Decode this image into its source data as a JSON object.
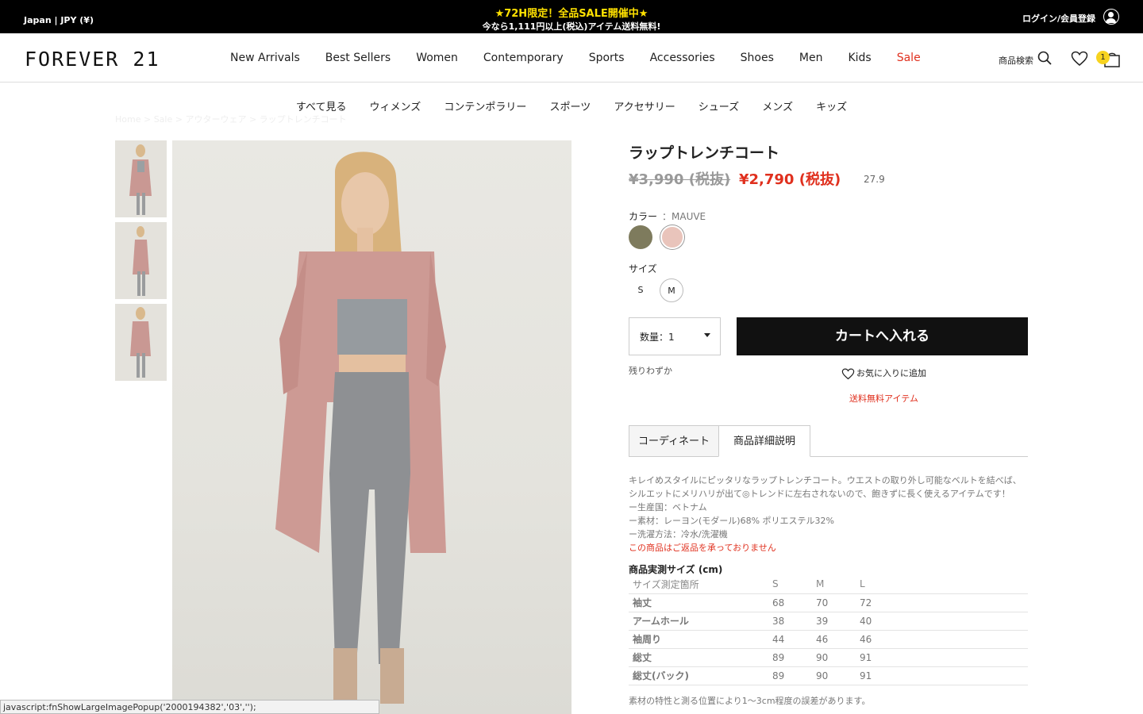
{
  "topbar": {
    "locale": "Japan | JPY (¥)",
    "promo_line1": "★72H限定！全品SALE開催中★",
    "promo_line2": "今なら1,111円以上(税込)アイテム送料無料!",
    "login": "ログイン/会員登録"
  },
  "header": {
    "logo": "FOREVER 21",
    "nav": [
      "New Arrivals",
      "Best Sellers",
      "Women",
      "Contemporary",
      "Sports",
      "Accessories",
      "Shoes",
      "Men",
      "Kids",
      "Sale"
    ],
    "search_label": "商品検索",
    "cart_count": "1"
  },
  "subnav": [
    "すべて見る",
    "ウィメンズ",
    "コンテンポラリー",
    "スポーツ",
    "アクセサリー",
    "シューズ",
    "メンズ",
    "キッズ"
  ],
  "breadcrumb": "Home > Sale > アウターウェア > ラップトレンチコート",
  "product": {
    "title": "ラップトレンチコート",
    "old_price": "¥3,990 (税抜)",
    "new_price": "¥2,790 (税抜)",
    "code": "27.9",
    "color_label": "カラー",
    "color_value": "：MAUVE",
    "colors": [
      "#7e7b5d",
      "#e9c4bb"
    ],
    "size_label": "サイズ",
    "sizes": [
      "S",
      "M"
    ],
    "qty_label": "数量：1",
    "cart_button": "カートへ入れる",
    "stock": "残りわずか",
    "favorite": "お気に入りに追加",
    "free_shipping": "送料無料アイテム"
  },
  "tabs": [
    "コーディネート",
    "商品詳細説明"
  ],
  "description": {
    "line1": "キレイめスタイルにピッタリなラップトレンチコート。ウエストの取り外し可能なベルトを結べば、シルエットにメリハリが出て◎トレンドに左右されないので、飽きずに長く使えるアイテムです！",
    "origin": "ー生産国：ベトナム",
    "material": "ー素材：レーヨン(モダール)68% ポリエステル32%",
    "wash": "ー洗濯方法：冷水/洗濯機",
    "warning": "この商品はご返品を承っておりません"
  },
  "size_chart": {
    "title": "商品実測サイズ (cm)",
    "headers": [
      "サイズ測定箇所",
      "S",
      "M",
      "L"
    ],
    "rows": [
      [
        "袖丈",
        "68",
        "70",
        "72"
      ],
      [
        "アームホール",
        "38",
        "39",
        "40"
      ],
      [
        "袖周り",
        "44",
        "46",
        "46"
      ],
      [
        "総丈",
        "89",
        "90",
        "91"
      ],
      [
        "総丈(バック)",
        "89",
        "90",
        "91"
      ]
    ],
    "footnote": "素材の特性と測る位置により1〜3cm程度の誤差があります。"
  },
  "status_bar": "javascript:fnShowLargeImagePopup('2000194382','03','');"
}
